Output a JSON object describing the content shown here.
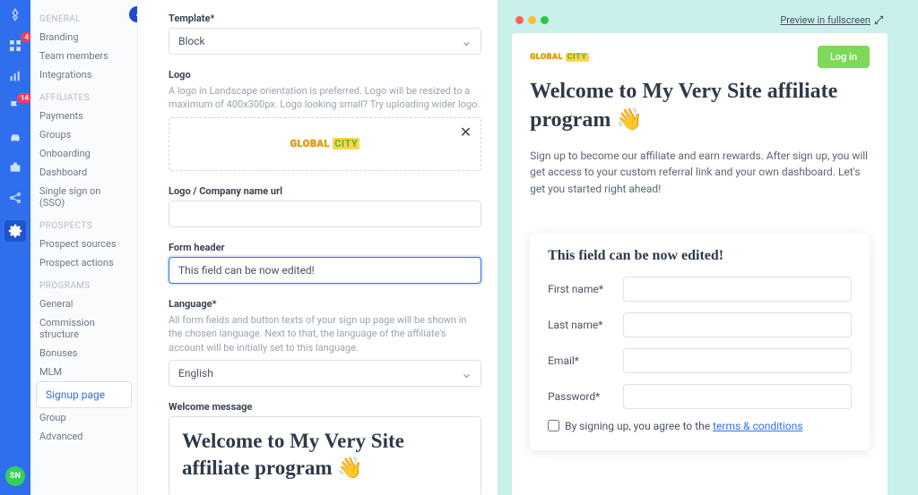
{
  "rail": {
    "badge1": "4",
    "badge2": "14",
    "avatar": "SN"
  },
  "sidebar": {
    "groups": [
      {
        "head": "GENERAL",
        "items": [
          "Branding",
          "Team members",
          "Integrations"
        ]
      },
      {
        "head": "AFFILIATES",
        "items": [
          "Payments",
          "Groups",
          "Onboarding",
          "Dashboard",
          "Single sign on (SSO)"
        ]
      },
      {
        "head": "PROSPECTS",
        "items": [
          "Prospect sources",
          "Prospect actions"
        ]
      },
      {
        "head": "PROGRAMS",
        "items": [
          "General",
          "Commission structure",
          "Bonuses",
          "MLM",
          "Signup page",
          "Group",
          "Advanced"
        ]
      }
    ],
    "selected": "Signup page"
  },
  "form": {
    "template_label": "Template*",
    "template_value": "Block",
    "logo_label": "Logo",
    "logo_hint": "A logo in Landscape orientation is preferred. Logo will be resized to a maximum of 400x300px. Logo looking small? Try uploading wider logo.",
    "logo_text_a": "GLOBAL",
    "logo_text_b": "CITY",
    "logo_url_label": "Logo / Company name url",
    "logo_url_value": "",
    "form_header_label": "Form header",
    "form_header_value": "This field can be now edited!",
    "language_label": "Language*",
    "language_hint": "All form fields and button texts of your sign up page will be shown in the chosen language. Next to that, the language of the affiliate's account will be initially set to this language.",
    "language_value": "English",
    "welcome_label": "Welcome message",
    "welcome_value": "Welcome to My Very Site affiliate program 👋"
  },
  "preview": {
    "fullscreen": "Preview in fullscreen",
    "login": "Log in",
    "heading": "Welcome to My Very Site affiliate program 👋",
    "paragraph": "Sign up to become our affiliate and earn rewards. After sign up, you will get access to your custom referral link and your own dashboard. Let's get you started right ahead!",
    "card_header": "This field can be now edited!",
    "fields": {
      "first_name": "First name*",
      "last_name": "Last name*",
      "email": "Email*",
      "password": "Password*"
    },
    "agree_pre": "By signing up, you agree to the ",
    "agree_link": "terms & conditions"
  }
}
